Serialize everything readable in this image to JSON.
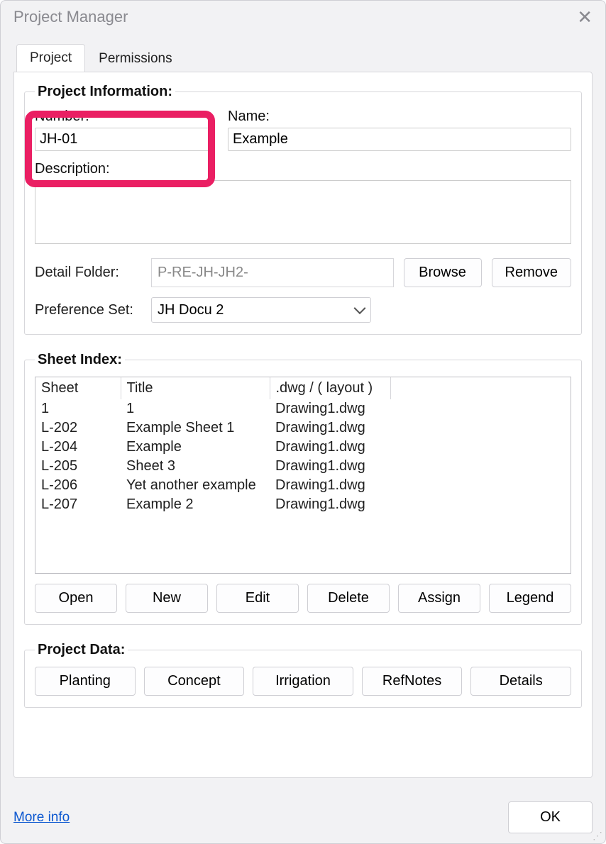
{
  "window": {
    "title": "Project Manager"
  },
  "tabs": {
    "project": "Project",
    "permissions": "Permissions",
    "active": "project"
  },
  "project_info": {
    "legend": "Project Information:",
    "number_label": "Number:",
    "number_value": "JH-01",
    "name_label": "Name:",
    "name_value": "Example",
    "description_label": "Description:",
    "description_value": "",
    "detail_folder_label": "Detail Folder:",
    "detail_folder_value": "P-RE-JH-JH2-",
    "browse_label": "Browse",
    "remove_label": "Remove",
    "preference_set_label": "Preference Set:",
    "preference_set_value": "JH Docu 2"
  },
  "sheet_index": {
    "legend": "Sheet Index:",
    "columns": {
      "sheet": "Sheet",
      "title": "Title",
      "dwg": ".dwg / ( layout )"
    },
    "rows": [
      {
        "sheet": "1",
        "title": "1",
        "dwg": "Drawing1.dwg"
      },
      {
        "sheet": "L-202",
        "title": "Example Sheet 1",
        "dwg": "Drawing1.dwg"
      },
      {
        "sheet": "L-204",
        "title": "Example",
        "dwg": "Drawing1.dwg"
      },
      {
        "sheet": "L-205",
        "title": "Sheet 3",
        "dwg": "Drawing1.dwg"
      },
      {
        "sheet": "L-206",
        "title": "Yet another example",
        "dwg": "Drawing1.dwg"
      },
      {
        "sheet": "L-207",
        "title": "Example 2",
        "dwg": "Drawing1.dwg"
      }
    ],
    "buttons": {
      "open": "Open",
      "new": "New",
      "edit": "Edit",
      "delete": "Delete",
      "assign": "Assign",
      "legend": "Legend"
    }
  },
  "project_data": {
    "legend": "Project Data:",
    "buttons": {
      "planting": "Planting",
      "concept": "Concept",
      "irrigation": "Irrigation",
      "refnotes": "RefNotes",
      "details": "Details"
    }
  },
  "footer": {
    "more_info": "More info",
    "ok": "OK"
  }
}
